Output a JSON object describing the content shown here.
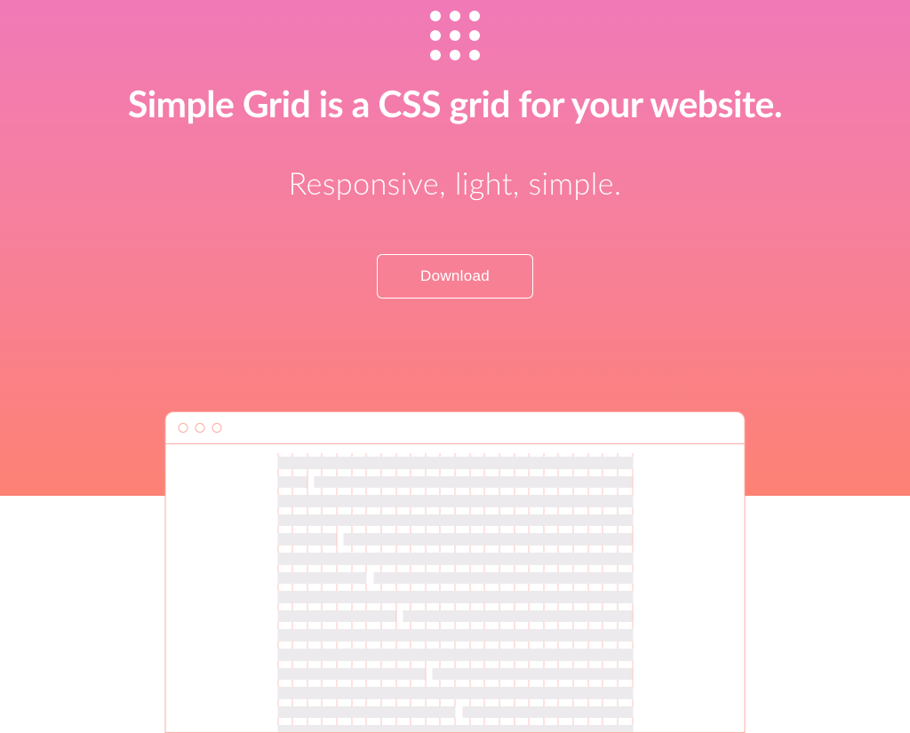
{
  "hero": {
    "headline": "Simple Grid is a CSS grid for your website.",
    "subhead": "Responsive, light, simple.",
    "download_label": "Download"
  },
  "colors": {
    "gradient_top": "#f179b7",
    "gradient_bottom": "#fd8174",
    "accent_border": "#fcaca3",
    "bar_fill": "#eceaec"
  },
  "logo": {
    "dots": 9
  },
  "browser": {
    "window_buttons": 3,
    "columns": 12,
    "rows": [
      {
        "gap_col": null
      },
      {
        "gap_col": 1
      },
      {
        "gap_col": null
      },
      {
        "gap_col": null
      },
      {
        "gap_col": 2
      },
      {
        "gap_col": null
      },
      {
        "gap_col": 3
      },
      {
        "gap_col": null
      },
      {
        "gap_col": 4
      },
      {
        "gap_col": null
      },
      {
        "gap_col": null
      },
      {
        "gap_col": 5
      },
      {
        "gap_col": null
      },
      {
        "gap_col": 6
      },
      {
        "gap_col": null
      }
    ]
  }
}
